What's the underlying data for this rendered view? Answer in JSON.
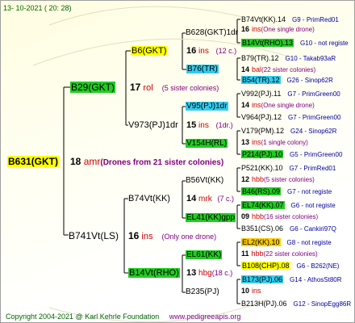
{
  "header": {
    "date": "13- 10-2021 ( 20: 28)"
  },
  "footer": {
    "copyright": "Copyright 2004-2021 @ Karl Kehrle Foundation",
    "url": "www.pedigreeapis.org"
  },
  "colors": {
    "green": "#22cc22",
    "yellow": "#ffff00",
    "cyan": "#33ccee",
    "orange": "#ffcc00",
    "red": "#cc0000",
    "purple": "#800080",
    "navy": "#0000a0"
  },
  "root": {
    "id": "B631(GKT)",
    "num": "18",
    "abbr": "amr",
    "note": "(Drones from 21 sister colonies)"
  },
  "gen1": {
    "b29": {
      "id": "B29(GKT)",
      "num": "17",
      "abbr": "rol",
      "note": "(5 sister colonies)"
    },
    "b741": {
      "id": "B741Vt(LS)",
      "num": "16",
      "abbr": "ins",
      "note": "(Only one drone)"
    }
  },
  "gen2": {
    "b6": {
      "id": "B6(GKT)",
      "num": "16",
      "abbr": "ins",
      "note": "(12 c.)"
    },
    "v973": {
      "id": "V973(PJ)1dr",
      "num": "15",
      "abbr": "ins",
      "note": "(1dr.)"
    },
    "b74": {
      "id": "B74Vt(KK)",
      "num": "14",
      "abbr": "mrk",
      "note": "(7 c.)"
    },
    "b14": {
      "id": "B14Vt(RHO)",
      "num": "13",
      "abbr": "hbg",
      "note": "(18 c.)"
    }
  },
  "gen3": {
    "b628": {
      "id": "B628(GKT)1dr"
    },
    "b76": {
      "id": "B76(TR)"
    },
    "v95": {
      "id": "V95(PJ)1dr"
    },
    "v154": {
      "id": "V154H(RL)"
    },
    "b56": {
      "id": "B56Vt(KK)"
    },
    "el41": {
      "id": "EL41(KK)gpp"
    },
    "el61": {
      "id": "EL61(KK)"
    },
    "b235": {
      "id": "B235(PJ)"
    }
  },
  "gen4": [
    {
      "id": "B74Vt(KK).14",
      "code": "G9 - PrimRed01"
    },
    {
      "num": "16",
      "abbr": "ins",
      "note": "(One single drone)"
    },
    {
      "id": "B14Vt(RHO).13",
      "code": "G10 - not registe"
    },
    {
      "id": "B79(TR).12",
      "code": "G10 - Takab93aR"
    },
    {
      "num": "14",
      "abbr": "bal",
      "note": "(22 sister colonies)"
    },
    {
      "id": "B54(TR).12",
      "code": "G26 - Sinop62R"
    },
    {
      "id": "V992(PJ).11",
      "code": "G7 - PrimGreen00"
    },
    {
      "num": "14",
      "abbr": "ins",
      "note": "(One single drone)"
    },
    {
      "id": "V964(PJ).12",
      "code": "G7 - PrimGreen00"
    },
    {
      "id": "V179(PM).12",
      "code": "G24 - Sinop62R"
    },
    {
      "num": "13",
      "abbr": "ins",
      "note": "(1 single colony)"
    },
    {
      "id": "P214(PJ).10",
      "code": "G5 - PrimGreen00"
    },
    {
      "id": "P521(KK).10",
      "code": "G7 - PrimRed01"
    },
    {
      "num": "12",
      "abbr": "hbb",
      "note": "(5 sister colonies)"
    },
    {
      "id": "B46(RS).09",
      "code": "G7 - not registe"
    },
    {
      "id": "EL74(KK).07",
      "code": "G6 - not registe"
    },
    {
      "num": "09",
      "abbr": "hbb",
      "note": "(16 sister colonies)"
    },
    {
      "id": "B351(CS).06",
      "code": "G6 - Cankiri97Q"
    },
    {
      "id": "EL2(KK).10",
      "code": "G8 - not registe"
    },
    {
      "num": "11",
      "abbr": "hbb",
      "note": "(22 sister colonies)"
    },
    {
      "id": "B108(CHP).08",
      "code": "G6 - B262(NE)"
    },
    {
      "id": "B173(PJ).06",
      "code": "G14 - AthosSt80R"
    },
    {
      "num": "10",
      "abbr": "ins",
      "note": ""
    },
    {
      "id": "B213H(PJ).06",
      "code": "G12 - SinopEgg86R"
    }
  ]
}
